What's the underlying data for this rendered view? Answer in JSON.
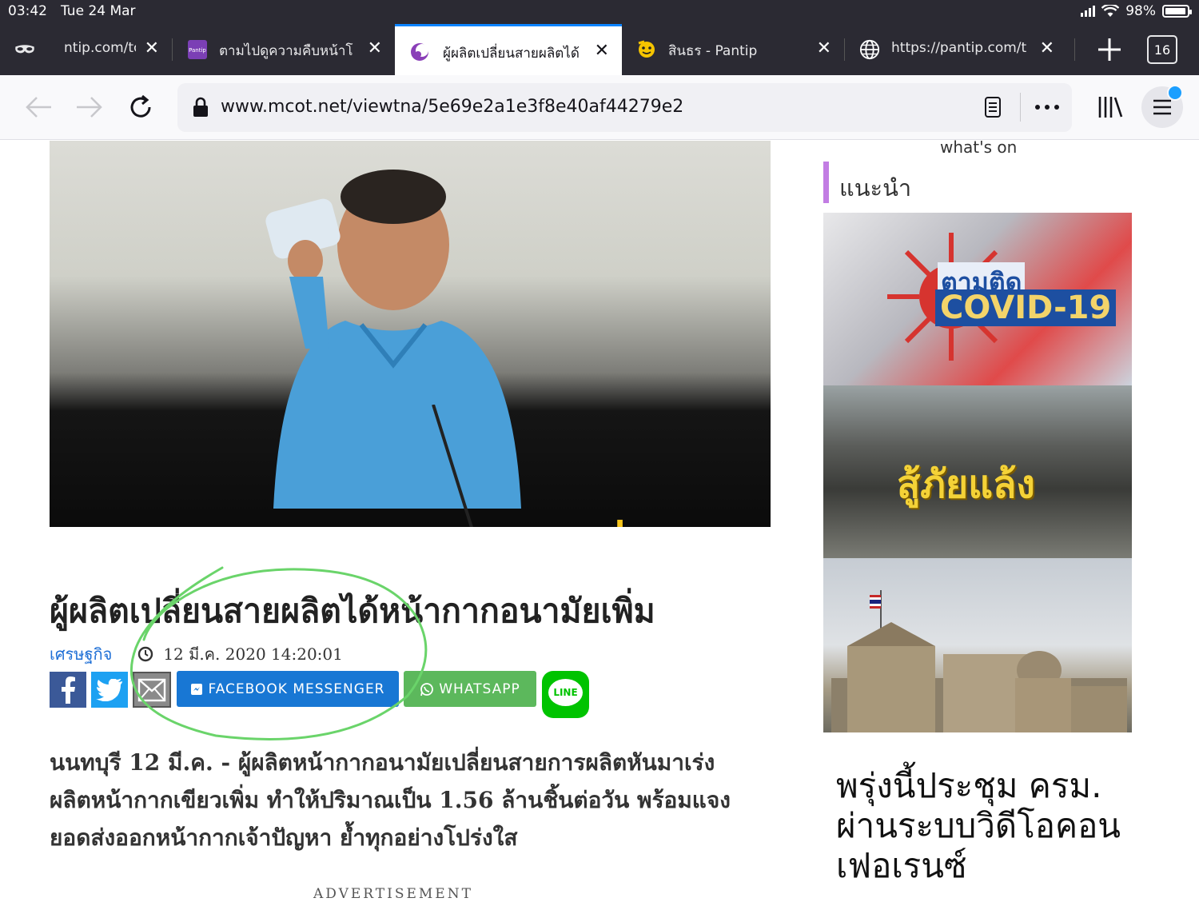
{
  "status": {
    "time": "03:42",
    "date": "Tue 24 Mar",
    "battery": "98%",
    "battery_level": 0.98
  },
  "tabs": [
    {
      "title": "ntip.com/tc",
      "icon": "mask-icon",
      "active": false
    },
    {
      "title": "ตามไปดูความคืบหน้าโ",
      "icon": "pantip-logo-icon",
      "active": false
    },
    {
      "title": "ผู้ผลิตเปลี่ยนสายผลิตได้",
      "icon": "mcot-logo-icon",
      "active": true
    },
    {
      "title": "สินธร - Pantip",
      "icon": "emoji-icon",
      "active": false
    },
    {
      "title": "https://pantip.com/tc",
      "icon": "globe-icon",
      "active": false
    }
  ],
  "tab_count": "16",
  "toolbar": {
    "url": "www.mcot.net/viewtna/5e69e2a1e3f8e40af44279e2"
  },
  "article": {
    "hero_caption": "ผลิตหน้ากากเขียวเพิ่ม",
    "title": "ผู้ผลิตเปลี่ยนสายผลิตได้หน้ากากอนามัยเพิ่ม",
    "category": "เศรษฐกิจ",
    "datetime": "12 มี.ค. 2020 14:20:01",
    "share": {
      "messenger": "FACEBOOK MESSENGER",
      "whatsapp": "WHATSAPP",
      "line": "LINE"
    },
    "lead_lines": [
      "นนทบุรี 12 มี.ค. - ผู้ผลิตหน้ากากอนามัยเปลี่ยนสายการผลิตหันมาเร่ง",
      "ผลิตหน้ากากเขียวเพิ่ม ทำให้ปริมาณเป็น 1.56 ล้านชิ้นต่อวัน พร้อมแจง",
      "ยอดส่งออกหน้ากากเจ้าปัญหา ย้ำทุกอย่างโปร่งใส"
    ],
    "advertisement": "ADVERTISEMENT"
  },
  "sidebar": {
    "whats_on": "what's on",
    "recommend": "แนะนำ",
    "card1_top": "ตามติด",
    "card1_main": "COVID-19",
    "card2_text": "สู้ภัยแล้ง",
    "story_title": "พรุ่งนี้ประชุม ครม. ผ่านระบบวิดีโอคอนเฟอเรนซ์"
  },
  "colors": {
    "accent_tab": "#0a84ff",
    "facebook": "#3b5998",
    "twitter": "#1da1f2",
    "messenger": "#1877d4",
    "whatsapp": "#5cb85c",
    "line": "#00c300",
    "annotation": "#6ad46a",
    "hero_text": "#f6c51b"
  }
}
